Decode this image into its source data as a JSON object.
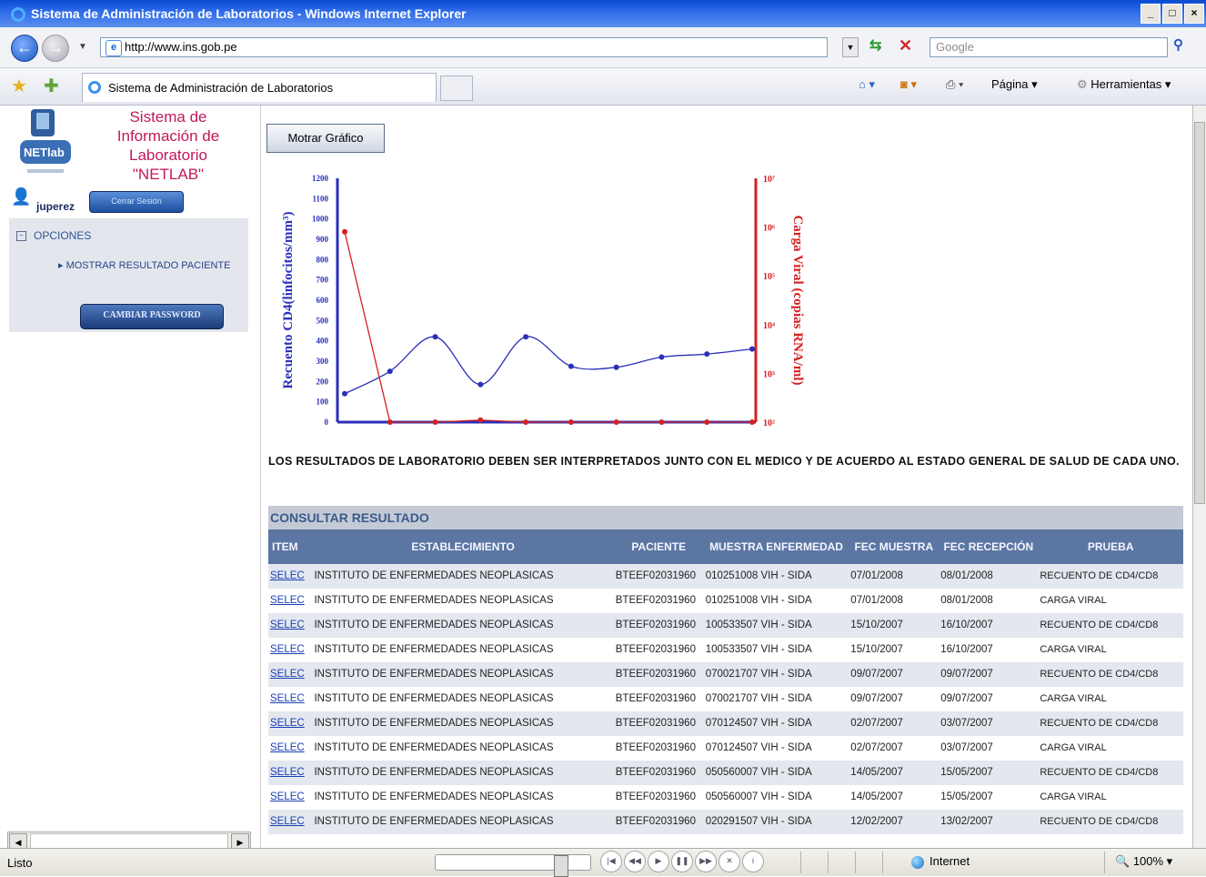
{
  "window": {
    "title": "Sistema de Administración de Laboratorios - Windows Internet Explorer",
    "controls": [
      "_",
      "□",
      "×"
    ]
  },
  "address_bar": {
    "url": "http://www.ins.gob.pe",
    "search_placeholder": "Google"
  },
  "favorites_bar": {
    "tab_title": "Sistema de Administración de Laboratorios",
    "page_menu": "Página",
    "tools_menu": "Herramientas"
  },
  "sidebar": {
    "system_name": "Sistema de Información de Laboratorio \"NETLAB\"",
    "username": "juperez",
    "logout_button": "Cerrar Sesión",
    "options_label": "OPCIONES",
    "menu_item": "MOSTRAR RESULTADO PACIENTE",
    "change_password_button": "CAMBIAR PASSWORD"
  },
  "main": {
    "show_chart_button": "Motrar Gráfico",
    "disclaimer": "LOS RESULTADOS DE LABORATORIO DEBEN SER INTERPRETADOS JUNTO CON EL MEDICO Y DE ACUERDO AL ESTADO GENERAL DE SALUD DE CADA UNO.",
    "results_title": "CONSULTAR RESULTADO",
    "columns": [
      "ITEM",
      "ESTABLECIMIENTO",
      "PACIENTE",
      "MUESTRA ENFERMEDAD",
      "FEC MUESTRA",
      "FEC RECEPCIÓN",
      "PRUEBA"
    ],
    "rows": [
      [
        "SELEC",
        "INSTITUTO DE ENFERMEDADES NEOPLASICAS",
        "BTEEF02031960",
        "010251008 VIH - SIDA",
        "07/01/2008",
        "08/01/2008",
        "RECUENTO DE CD4/CD8"
      ],
      [
        "SELEC",
        "INSTITUTO DE ENFERMEDADES NEOPLASICAS",
        "BTEEF02031960",
        "010251008 VIH - SIDA",
        "07/01/2008",
        "08/01/2008",
        "CARGA VIRAL"
      ],
      [
        "SELEC",
        "INSTITUTO DE ENFERMEDADES NEOPLASICAS",
        "BTEEF02031960",
        "100533507 VIH - SIDA",
        "15/10/2007",
        "16/10/2007",
        "RECUENTO DE CD4/CD8"
      ],
      [
        "SELEC",
        "INSTITUTO DE ENFERMEDADES NEOPLASICAS",
        "BTEEF02031960",
        "100533507 VIH - SIDA",
        "15/10/2007",
        "16/10/2007",
        "CARGA VIRAL"
      ],
      [
        "SELEC",
        "INSTITUTO DE ENFERMEDADES NEOPLASICAS",
        "BTEEF02031960",
        "070021707 VIH - SIDA",
        "09/07/2007",
        "09/07/2007",
        "RECUENTO DE CD4/CD8"
      ],
      [
        "SELEC",
        "INSTITUTO DE ENFERMEDADES NEOPLASICAS",
        "BTEEF02031960",
        "070021707 VIH - SIDA",
        "09/07/2007",
        "09/07/2007",
        "CARGA VIRAL"
      ],
      [
        "SELEC",
        "INSTITUTO DE ENFERMEDADES NEOPLASICAS",
        "BTEEF02031960",
        "070124507 VIH - SIDA",
        "02/07/2007",
        "03/07/2007",
        "RECUENTO DE CD4/CD8"
      ],
      [
        "SELEC",
        "INSTITUTO DE ENFERMEDADES NEOPLASICAS",
        "BTEEF02031960",
        "070124507 VIH - SIDA",
        "02/07/2007",
        "03/07/2007",
        "CARGA VIRAL"
      ],
      [
        "SELEC",
        "INSTITUTO DE ENFERMEDADES NEOPLASICAS",
        "BTEEF02031960",
        "050560007 VIH - SIDA",
        "14/05/2007",
        "15/05/2007",
        "RECUENTO DE CD4/CD8"
      ],
      [
        "SELEC",
        "INSTITUTO DE ENFERMEDADES NEOPLASICAS",
        "BTEEF02031960",
        "050560007 VIH - SIDA",
        "14/05/2007",
        "15/05/2007",
        "CARGA VIRAL"
      ],
      [
        "SELEC",
        "INSTITUTO DE ENFERMEDADES NEOPLASICAS",
        "BTEEF02031960",
        "020291507 VIH - SIDA",
        "12/02/2007",
        "13/02/2007",
        "RECUENTO DE CD4/CD8"
      ]
    ]
  },
  "status_bar": {
    "status": "Listo",
    "zone": "Internet",
    "zoom": "100%"
  },
  "colors": {
    "cd4_series": "#2b2fb8",
    "viral_series": "#d42020",
    "table_header": "#5c76a3"
  },
  "chart_data": {
    "type": "line",
    "left_axis": {
      "label": "Recuento CD4(linfocitos/mm³)",
      "ylim": [
        0,
        1200
      ],
      "ticks": [
        "0",
        "100",
        "200",
        "300",
        "400",
        "500",
        "600",
        "700",
        "800",
        "900",
        "1000",
        "1100",
        "1200"
      ]
    },
    "right_axis": {
      "label": "Carga Viral (copias RNA/ml)",
      "scale": "log",
      "ticks": [
        "10²",
        "10³",
        "10⁴",
        "10⁵",
        "10⁶",
        "10⁷"
      ]
    },
    "series": [
      {
        "axis": "left",
        "values": [
          140,
          250,
          420,
          185,
          420,
          275,
          270,
          320,
          335,
          360
        ]
      },
      {
        "axis": "right",
        "values": [
          800000,
          100,
          100,
          110,
          100,
          100,
          100,
          100,
          100,
          100
        ]
      }
    ],
    "grid": false
  }
}
